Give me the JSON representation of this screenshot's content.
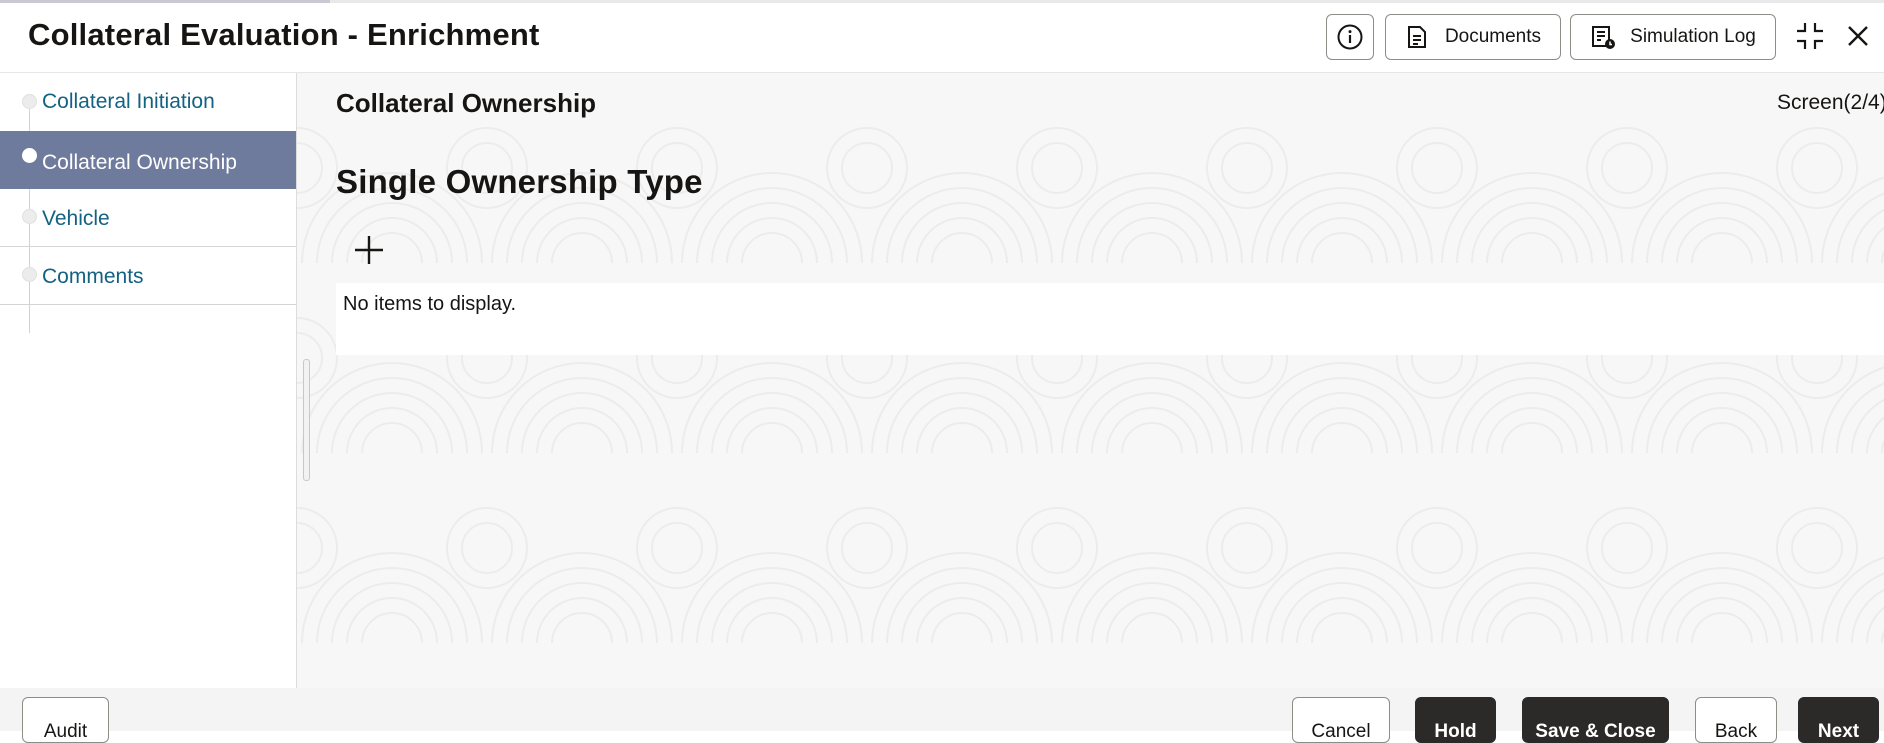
{
  "header": {
    "title": "Collateral Evaluation - Enrichment",
    "info_icon": "info-icon",
    "documents_label": "Documents",
    "documents_icon": "document-icon",
    "simulation_log_label": "Simulation Log",
    "simulation_log_icon": "log-icon",
    "minimize_icon": "collapse-icon",
    "close_icon": "close-icon"
  },
  "sidebar": {
    "items": [
      {
        "label": "Collateral Initiation",
        "active": false
      },
      {
        "label": "Collateral Ownership",
        "active": true
      },
      {
        "label": "Vehicle",
        "active": false
      },
      {
        "label": "Comments",
        "active": false
      }
    ]
  },
  "main": {
    "section_title": "Collateral Ownership",
    "screen_indicator": "Screen(2/4)",
    "subsection_title": "Single Ownership Type",
    "add_icon": "plus-icon",
    "empty_message": "No items to display."
  },
  "footer": {
    "audit_label": "Audit",
    "cancel_label": "Cancel",
    "hold_label": "Hold",
    "save_close_label": "Save & Close",
    "back_label": "Back",
    "next_label": "Next"
  },
  "colors": {
    "sidebar_active": "#6e7b9c",
    "sidebar_link": "#146282",
    "primary_button": "#2b2a28"
  }
}
